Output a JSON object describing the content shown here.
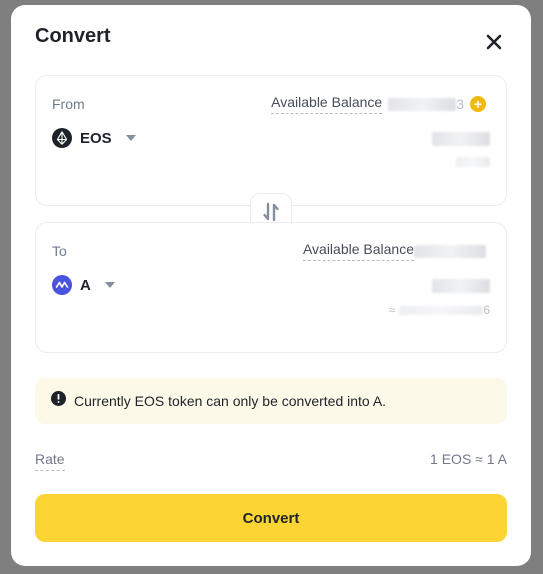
{
  "modal": {
    "title": "Convert",
    "close_icon": "close-icon"
  },
  "from": {
    "label": "From",
    "balance_label": "Available Balance",
    "balance_suffix": "3",
    "token": "EOS",
    "token_icon": "eos-icon",
    "add_icon": "plus-circle-icon"
  },
  "to": {
    "label": "To",
    "balance_label": "Available Balance",
    "token": "A",
    "token_icon": "a-token-icon",
    "approx_prefix": "≈",
    "approx_suffix": "6"
  },
  "swap_icon": "swap-icon",
  "notice": {
    "icon": "exclamation-circle-icon",
    "text": "Currently EOS token can only be converted into A."
  },
  "rate": {
    "label": "Rate",
    "value": "1 EOS ≈ 1 A"
  },
  "convert_button": "Convert",
  "colors": {
    "accent": "#fcd535",
    "plus": "#f0b90b",
    "notice_bg": "#fdf9e9",
    "a_token": "#4a52e0"
  }
}
